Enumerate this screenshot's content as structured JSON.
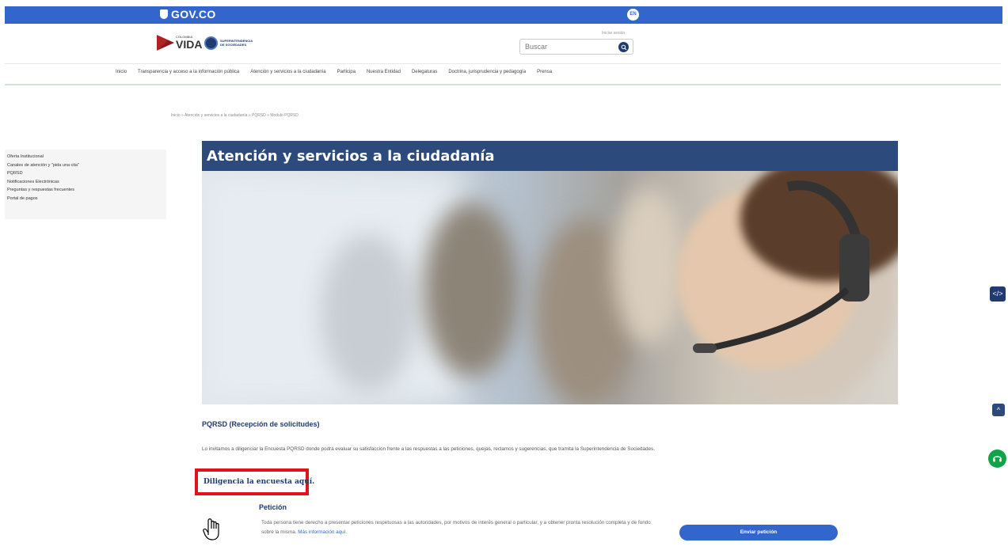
{
  "gov_bar": {
    "logo_text": "GOV.CO",
    "lang_button": "EN"
  },
  "header": {
    "colombia_logo": {
      "small_text": "COLOMBIA",
      "main_text": "VIDA"
    },
    "super_logo": {
      "text": "SUPERINTENDENCIA DE SOCIEDADES"
    },
    "login_link": "Iniciar sesión",
    "search": {
      "placeholder": "Buscar",
      "value": ""
    }
  },
  "nav": {
    "items": [
      "Inicio",
      "Transparencia y acceso a la información pública",
      "Atención y servicios a la ciudadanía",
      "Participa",
      "Nuestra Entidad",
      "Delegaturas",
      "Doctrina, jurisprudencia y pedagogía",
      "Prensa"
    ]
  },
  "breadcrumb": "Inicio » Atención y servicios a la ciudadanía » PQRSD » Modulo PQRSD",
  "sidebar": {
    "items": [
      "Oferta Institucional",
      "Canales de atención y \"pida una cita\"",
      "PQRSD",
      "Notificaciones Electrónicas",
      "Preguntas y respuestas frecuentes",
      "Portal de pagos"
    ]
  },
  "main": {
    "hero_title": "Atención y servicios a la ciudadanía",
    "section_title": "PQRSD (Recepción de solicitudes)",
    "invite_text": "Lo invitamos a diligenciar la Encuesta PQRSD donde podrá evaluar su satisfacción frente a las respuestas a las peticiones, quejas, reclamos y sugerencias, que tramita la Superintendencia de Sociedades.",
    "survey_link": "Diligencia la encuesta aquí.",
    "peticion": {
      "title": "Petición",
      "text": "Toda persona tiene derecho a presentar peticiones respetuosas a las autoridades, por motivos de interés general o particular, y a obtener pronta resolución completa y de fondo sobre la misma.",
      "more_link": "Más información aquí.",
      "button": "Enviar petición"
    }
  },
  "floating": {
    "accessibility": "</>",
    "scroll_up": "^"
  },
  "colors": {
    "gov_blue": "#3366cc",
    "navy": "#2c4a7c",
    "highlight_red": "#e0131b",
    "help_green": "#10a34a"
  }
}
